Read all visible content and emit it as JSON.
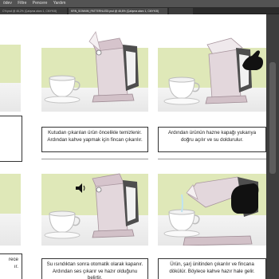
{
  "menubar": {
    "items": [
      "ödev",
      "Filtre",
      "Pencere",
      "Yardım"
    ]
  },
  "tabs": [
    {
      "label": "C%.psd @ 46,2% (Çalışma alanı 1, CMYK/8)",
      "active": false
    },
    {
      "label": "KRN_SONNIM_PATTERNLEDI.psd @ 46,6% (Çalışma alanı 1, CMYK/8)",
      "active": true
    },
    {
      "label": "",
      "active": false
    }
  ],
  "captions": {
    "step2": "Kutudan çıkarılan ürün öncelikle temizlenir. Ardından kahve yapmak için fincan çıkarılır.",
    "step3": "Ardından ürünün hazne kapağı yukarıya doğru açılır ve su doldurulur.",
    "step1_partial": "rece",
    "step1_partial_2": "ır.",
    "step5": "Su ısındıktan sonra otomatik olarak kapanır. Ardından ses çıkarır ve hazır olduğunu belirtir.",
    "step6": "Ürün, şarj ünitinden çıkarılır ve fincana dökülür. Böylece kahve hazır hale gelir."
  },
  "colors": {
    "accent_green": "#dfe8b8",
    "machine_body": "#d8c8cf",
    "machine_dark": "#4a4a4a"
  }
}
